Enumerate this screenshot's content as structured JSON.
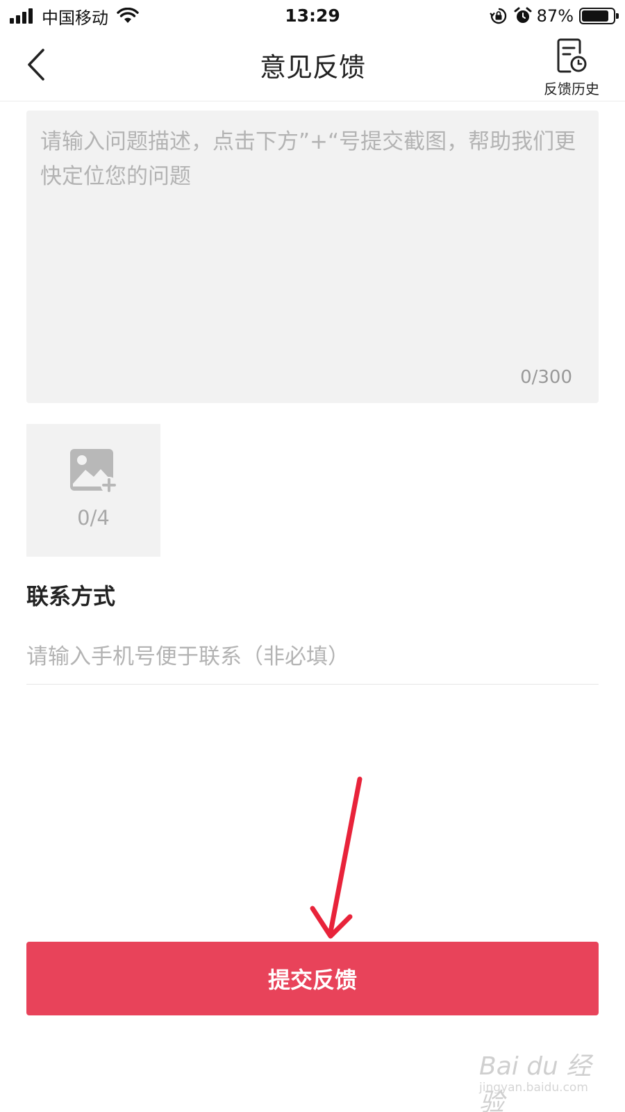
{
  "status_bar": {
    "carrier": "中国移动",
    "time": "13:29",
    "battery_percent": "87%",
    "battery_level": 0.87,
    "icons": [
      "signal-icon",
      "wifi-icon",
      "rotation-lock-icon",
      "alarm-icon",
      "battery-icon"
    ]
  },
  "nav": {
    "title": "意见反馈",
    "history_label": "反馈历史"
  },
  "feedback": {
    "value": "",
    "placeholder": "请输入问题描述，点击下方”+“号提交截图，帮助我们更快定位您的问题",
    "char_count": "0/300"
  },
  "upload": {
    "count": "0/4"
  },
  "contact": {
    "heading": "联系方式",
    "value": "",
    "placeholder": "请输入手机号便于联系（非必填）"
  },
  "submit": {
    "label": "提交反馈"
  },
  "watermark": {
    "brand": "Bai du 经验",
    "url": "jingyan.baidu.com"
  },
  "colors": {
    "accent": "#e8435a",
    "input_bg": "#f2f2f2",
    "placeholder": "#b3b3b3",
    "annotation": "#e8233a"
  }
}
